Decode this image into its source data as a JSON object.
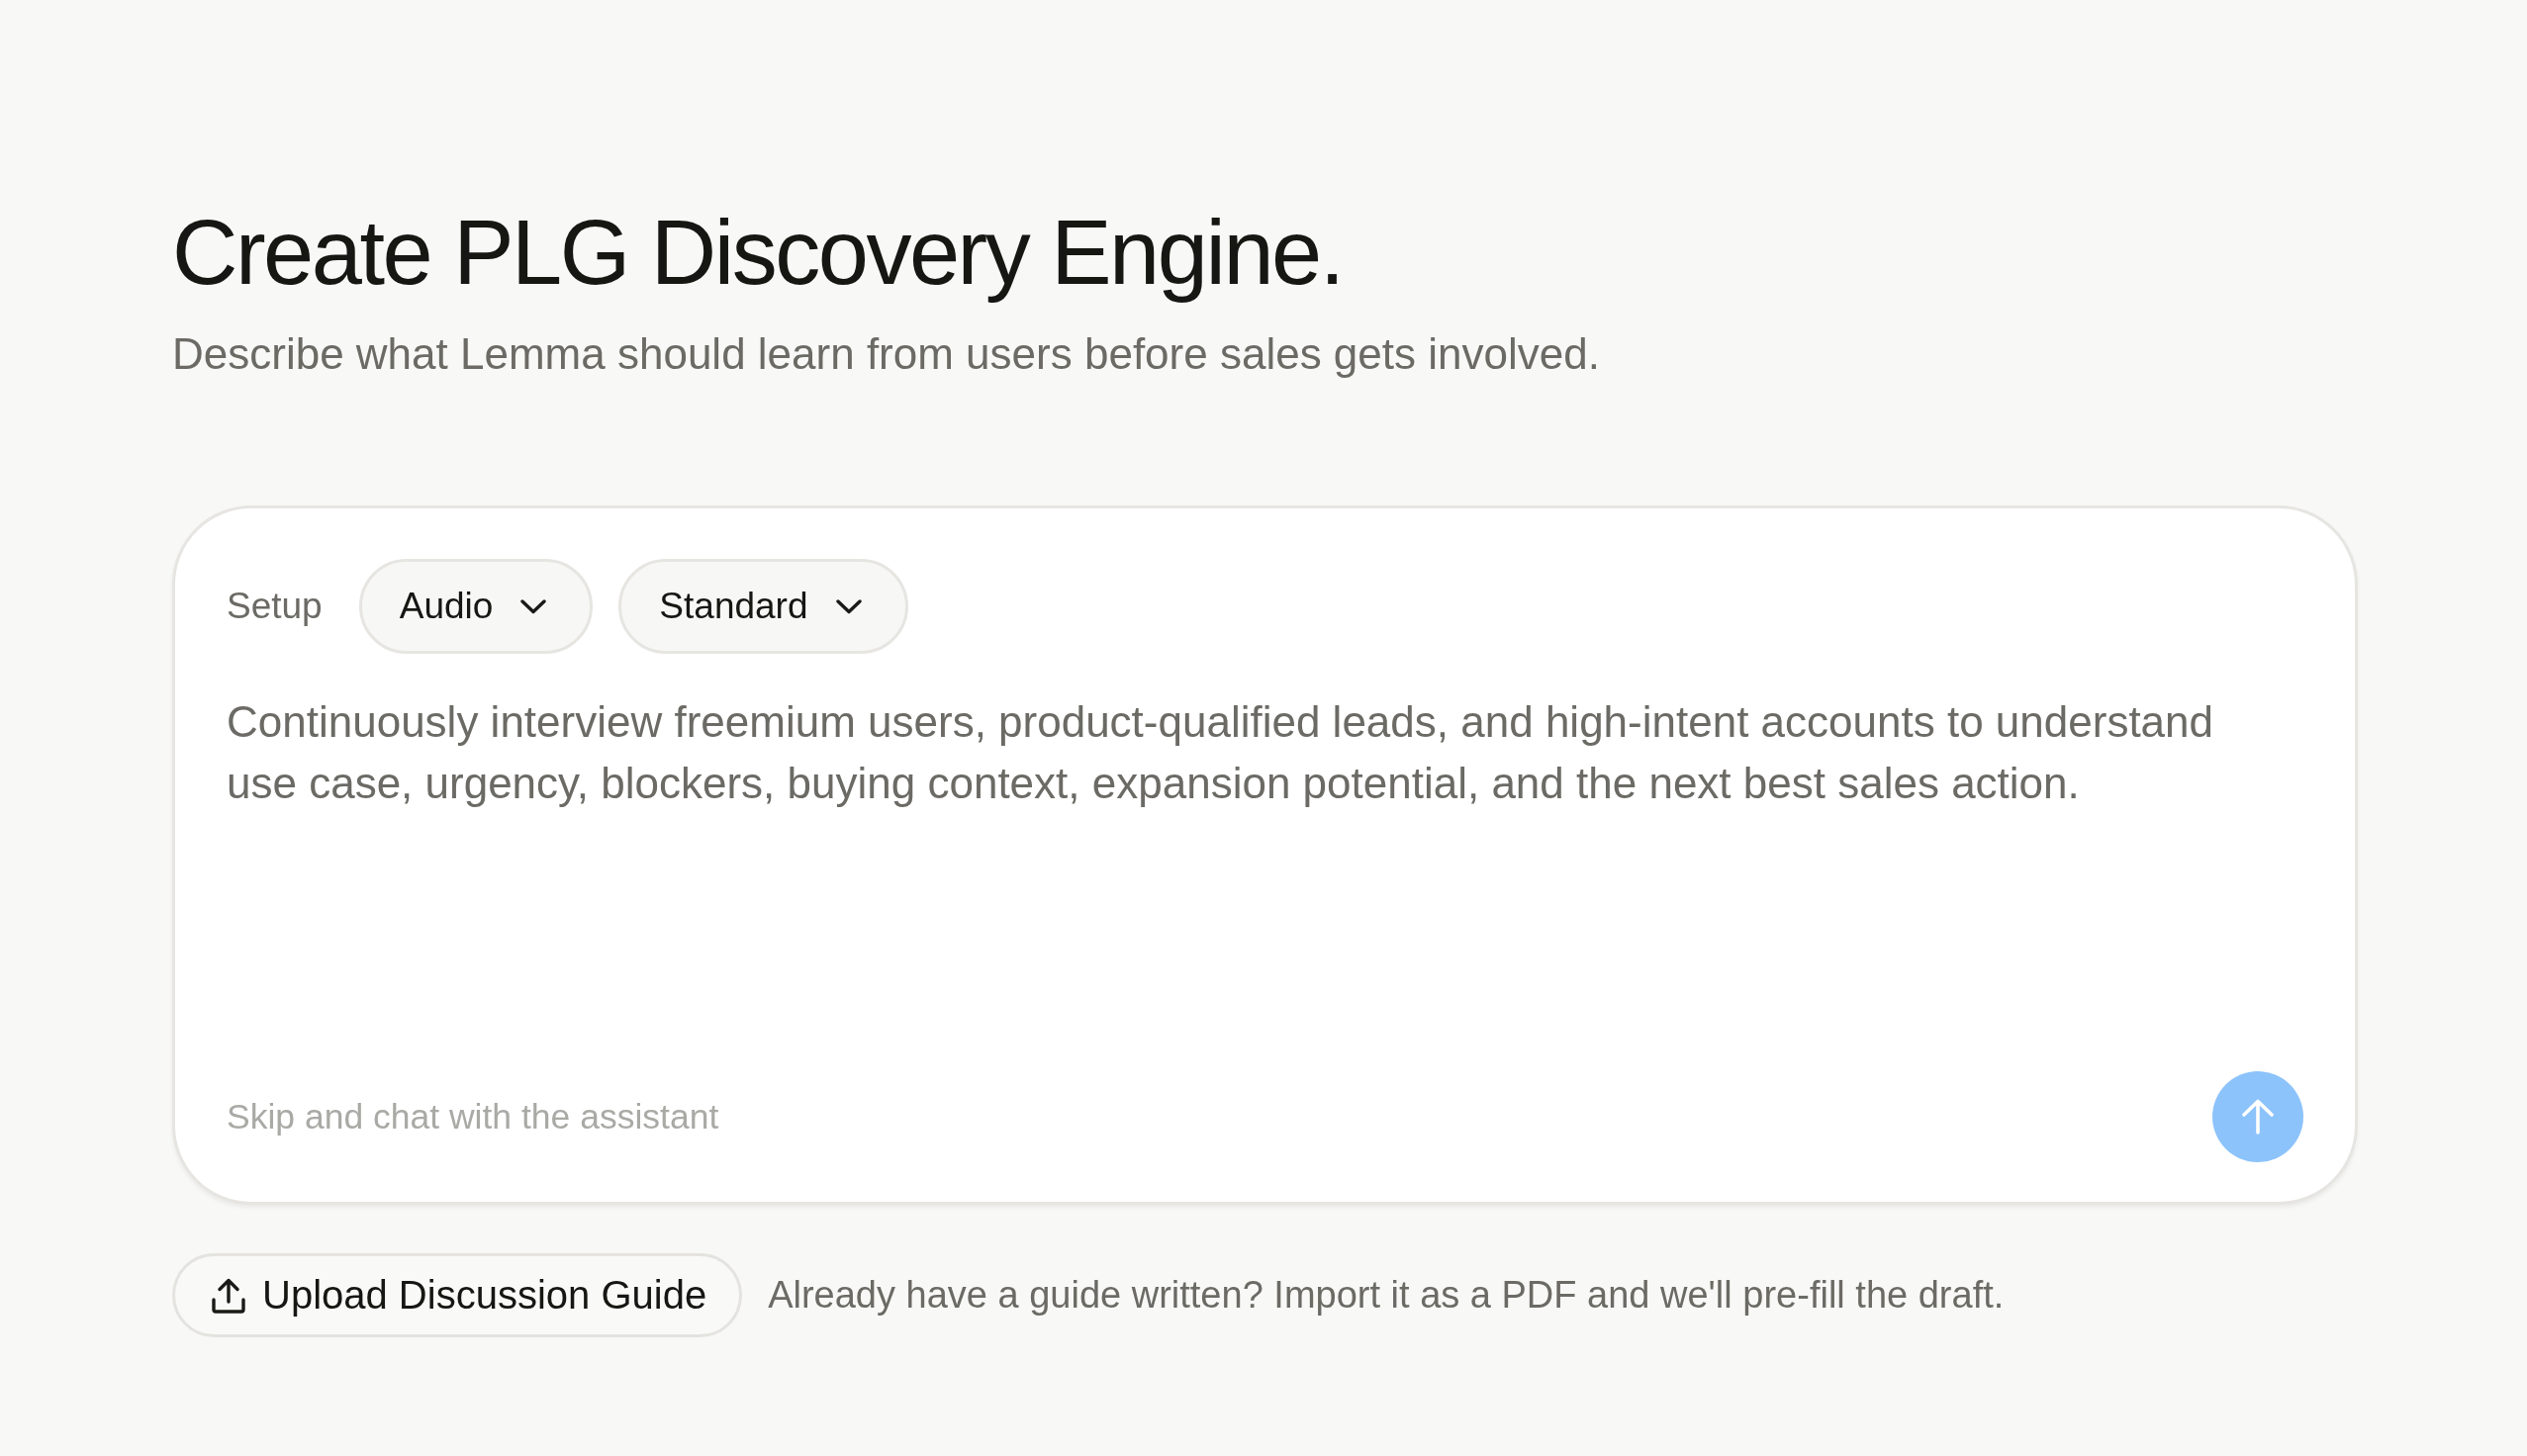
{
  "page": {
    "title": "Create PLG Discovery Engine.",
    "subtitle": "Describe what Lemma should learn from users before sales gets involved."
  },
  "composer": {
    "setup_label": "Setup",
    "dropdowns": [
      {
        "label": "Audio"
      },
      {
        "label": "Standard"
      }
    ],
    "prompt": {
      "placeholder": "Continuously interview freemium users, product-qualified leads, and high-intent accounts to understand use case, urgency, blockers, buying context, expansion potential, and the next best sales action."
    },
    "skip_link": "Skip and chat with the assistant",
    "send_button": {
      "disabled": true
    }
  },
  "upload": {
    "button": "Upload Discussion Guide",
    "hint": "Already have a guide written? Import it as a PDF and we'll pre-fill the draft."
  }
}
